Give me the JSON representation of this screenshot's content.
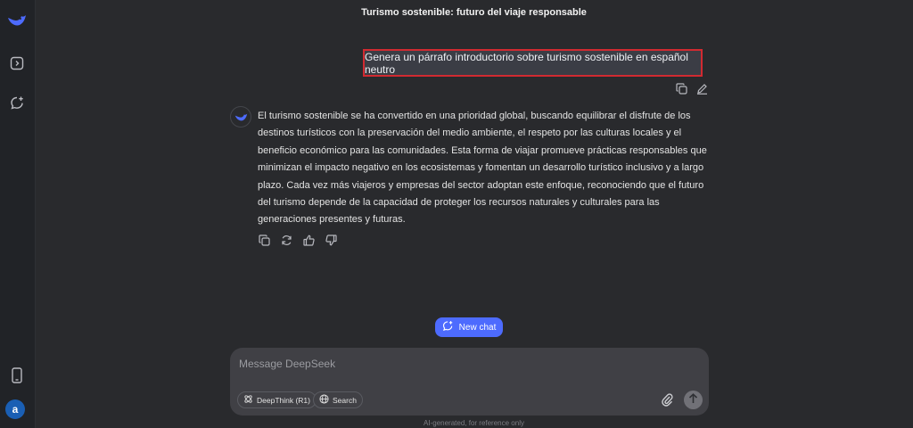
{
  "conversation": {
    "title": "Turismo sostenible: futuro del viaje responsable",
    "user_message": "Genera un párrafo introductorio sobre turismo sostenible en español neutro",
    "assistant_message": "El turismo sostenible se ha convertido en una prioridad global, buscando equilibrar el disfrute de los destinos turísticos con la preservación del medio ambiente, el respeto por las culturas locales y el beneficio económico para las comunidades. Esta forma de viajar promueve prácticas responsables que minimizan el impacto negativo en los ecosistemas y fomentan un desarrollo turístico inclusivo y a largo plazo. Cada vez más viajeros y empresas del sector adoptan este enfoque, reconociendo que el futuro del turismo depende de la capacidad de proteger los recursos naturales y culturales para las generaciones presentes y futuras."
  },
  "new_chat_label": "New chat",
  "composer": {
    "placeholder": "Message DeepSeek",
    "deepthink_label": "DeepThink (R1)",
    "search_label": "Search"
  },
  "user": {
    "avatar_letter": "a"
  },
  "footer": "AI-generated, for reference only",
  "colors": {
    "accent": "#4d6bfe",
    "highlight_border": "#d12a31",
    "background": "#292a2d",
    "sidebar": "#212327"
  },
  "icons": [
    "deepseek-logo-icon",
    "sidebar-toggle-icon",
    "new-chat-icon",
    "phone-icon",
    "copy-icon",
    "edit-icon",
    "regenerate-icon",
    "thumbs-up-icon",
    "thumbs-down-icon",
    "deepthink-icon",
    "globe-icon",
    "paperclip-icon",
    "send-arrow-icon"
  ]
}
